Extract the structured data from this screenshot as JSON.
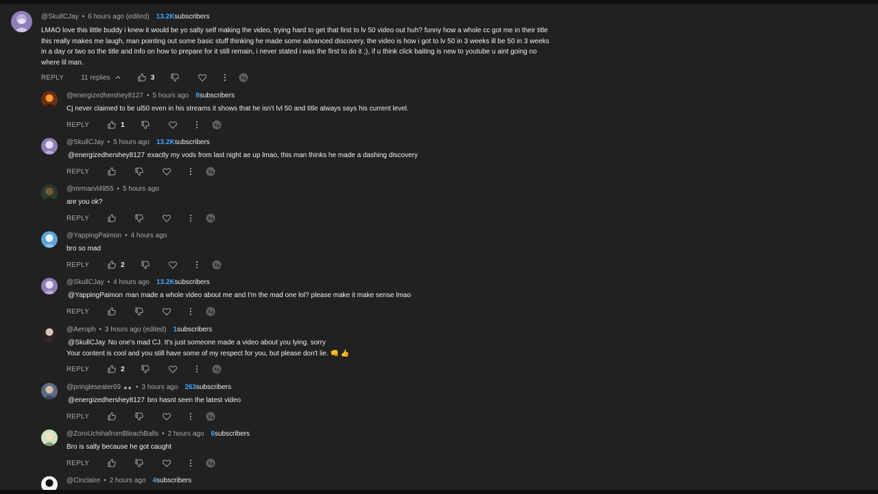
{
  "top_comment": {
    "author": "@SkullCJay",
    "time": "6 hours ago (edited)",
    "subs_count": "13.2K",
    "subs_label": "subscribers",
    "lines": [
      "LMAO love this little buddy i knew it would be yo salty self making the video, trying hard to get that first to lv 50 video out huh? funny how a whole cc got me in their title",
      "this really makes me laugh, man pointing out some basic stuff thinking he made some advanced discovery, the video is how i got to lv 50 in 3 weeks ill be 50 in 3 weeks",
      "in a day or two so the title and info on how to prepare for it still remain, i never stated i was the first to do it ;), if u think click baiting is new to youtube u aint going no",
      "where lil man."
    ],
    "reply_label": "REPLY",
    "replies_label": "11 replies",
    "likes": "3"
  },
  "replies": [
    {
      "author": "@energizedhershey8127",
      "time": "5 hours ago",
      "subs_count": "8",
      "subs_label": "subscribers",
      "mention": "",
      "text": "Cj never claimed to be ul50 even in his streams it shows that he isn't lvl 50 and title always says his current level.",
      "text2": "",
      "likes": "1",
      "reply_label": "REPLY"
    },
    {
      "author": "@SkullCJay",
      "time": "5 hours ago",
      "subs_count": "13.2K",
      "subs_label": "subscribers",
      "mention": "@energizedhershey8127",
      "text": "exactly my vods from last night ae up lmao, this man thinks he made a dashing discovery",
      "text2": "",
      "likes": "",
      "reply_label": "REPLY"
    },
    {
      "author": "@mrmarvl4955",
      "time": "5 hours ago",
      "subs_count": "",
      "subs_label": "",
      "mention": "",
      "text": "are you ok?",
      "text2": "",
      "likes": "",
      "reply_label": "REPLY"
    },
    {
      "author": "@YappingPaimon",
      "time": "4 hours ago",
      "subs_count": "",
      "subs_label": "",
      "mention": "",
      "text": "bro so mad",
      "text2": "",
      "likes": "2",
      "reply_label": "REPLY"
    },
    {
      "author": "@SkullCJay",
      "time": "4 hours ago",
      "subs_count": "13.2K",
      "subs_label": "subscribers",
      "mention": "@YappingPaimon",
      "text": "man made a whole video about me and I'm the mad one lol? please make it make sense lmao",
      "text2": "",
      "likes": "",
      "reply_label": "REPLY"
    },
    {
      "author": "@Aeroph",
      "time": "3 hours ago (edited)",
      "subs_count": "1",
      "subs_label": "subscribers",
      "mention": "@SkullCJay",
      "text": "No one's mad CJ. It's just someone made a video about you lying. sorry",
      "text2": "Your content is cool and you still have some of my respect for you, but please don't lie. 👊 👍",
      "likes": "2",
      "reply_label": "REPLY"
    },
    {
      "author": "@pringleseater69",
      "time": "3 hours ago",
      "subs_count": "263",
      "subs_label": "subscribers",
      "badge": "●●",
      "mention": "@energizedhershey8127",
      "text": "bro hasnt seen the latest video",
      "text2": "",
      "likes": "",
      "reply_label": "REPLY"
    },
    {
      "author": "@ZoroUchihafromBleachBalls",
      "time": "2 hours ago",
      "subs_count": "6",
      "subs_label": "subscribers",
      "mention": "",
      "text": "Bro is salty because he got caught",
      "text2": "",
      "likes": "",
      "reply_label": "REPLY"
    },
    {
      "author": "@Cinclaire",
      "time": "2 hours ago",
      "subs_count": "4",
      "subs_label": "subscribers",
      "mention": "",
      "text": "",
      "text2": "",
      "likes": "",
      "reply_label": ""
    }
  ],
  "colors": {
    "background": "#212121",
    "text": "#f1f1f1",
    "muted": "#aaaaaa",
    "subscribers_accent": "#3ea6ff"
  },
  "icons": [
    "like-icon",
    "dislike-icon",
    "heart-icon",
    "more-icon",
    "translate-icon",
    "chevron-up-icon"
  ]
}
